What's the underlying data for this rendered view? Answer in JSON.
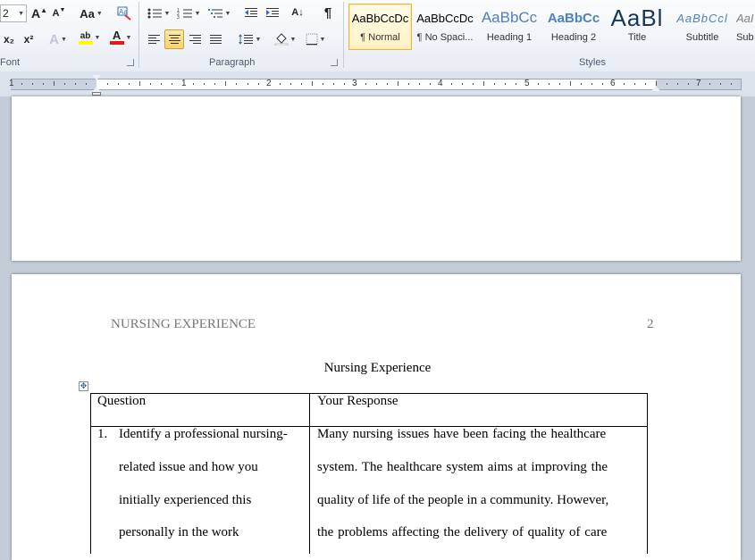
{
  "ribbon": {
    "font_size_value": "2",
    "groups": {
      "font": "Font",
      "paragraph": "Paragraph",
      "styles": "Styles"
    },
    "font_buttons": {
      "grow": "A",
      "shrink": "A",
      "change_case": "Aa",
      "subscript": "x₂",
      "superscript": "x²",
      "highlight": "ab",
      "font_color": "A"
    },
    "para_buttons": {
      "pilcrow": "¶",
      "sort": "A↓"
    },
    "styles": [
      {
        "sample": "AaBbCcDc",
        "name": "¶ Normal"
      },
      {
        "sample": "AaBbCcDc",
        "name": "¶ No Spaci..."
      },
      {
        "sample": "AaBbCc",
        "name": "Heading 1"
      },
      {
        "sample": "AaBbCc",
        "name": "Heading 2"
      },
      {
        "sample": "AaBl",
        "name": "Title"
      },
      {
        "sample": "AaBbCcl",
        "name": "Subtitle"
      },
      {
        "sample": "AaI",
        "name": "Sub"
      }
    ],
    "colors": {
      "highlight": "#ffff00",
      "font_color": "#e01b1b",
      "heading": "#4f81bd"
    }
  },
  "ruler": {
    "numbers": [
      "1",
      "1",
      "2",
      "3",
      "4",
      "5",
      "6",
      "7"
    ]
  },
  "document": {
    "running_head": "NURSING EXPERIENCE",
    "page_number": "2",
    "title": "Nursing Experience",
    "table": {
      "headers": [
        "Question",
        "Your Response"
      ],
      "question_number": "1.",
      "question_lines": [
        "Identify a professional nursing-",
        "related issue and how you",
        "initially experienced this",
        "personally in the work"
      ],
      "response_lines": [
        "Many nursing issues have been facing the healthcare",
        "system. The healthcare system aims at improving the",
        "quality of life of the people in a community. However,",
        "the problems affecting the delivery of quality of care"
      ]
    }
  }
}
